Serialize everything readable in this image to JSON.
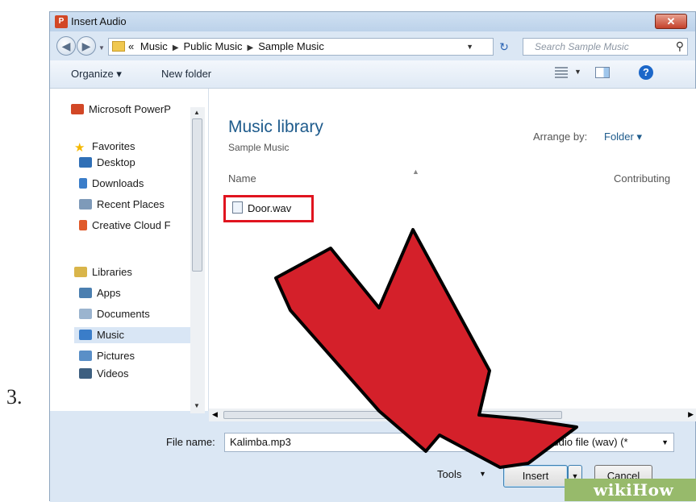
{
  "step": {
    "number": "3."
  },
  "window": {
    "title": "Insert Audio",
    "app_icon": "P"
  },
  "address": {
    "prefix": "«",
    "crumbs": [
      "Music",
      "Public Music",
      "Sample Music"
    ],
    "search_placeholder": "Search Sample Music"
  },
  "toolbar": {
    "organize_label": "Organize ▾",
    "new_folder_label": "New folder"
  },
  "sidebar": {
    "items": [
      {
        "label": "Microsoft PowerP",
        "icon": "powerpoint-icon",
        "color": "#d24726"
      },
      {
        "label": "Favorites",
        "icon": "star-icon",
        "color": "#f5b800"
      },
      {
        "label": "Desktop",
        "icon": "desktop-icon",
        "color": "#2f6fb6"
      },
      {
        "label": "Downloads",
        "icon": "downloads-icon",
        "color": "#3a7dc9"
      },
      {
        "label": "Recent Places",
        "icon": "recent-places-icon",
        "color": "#7e9ab9"
      },
      {
        "label": "Creative Cloud F",
        "icon": "creative-cloud-icon",
        "color": "#e05a2a"
      },
      {
        "label": "Libraries",
        "icon": "libraries-icon",
        "color": "#d9b54a"
      },
      {
        "label": "Apps",
        "icon": "apps-icon",
        "color": "#4b7fb0"
      },
      {
        "label": "Documents",
        "icon": "documents-icon",
        "color": "#9bb4cf"
      },
      {
        "label": "Music",
        "icon": "music-icon",
        "color": "#3a7dc9"
      },
      {
        "label": "Pictures",
        "icon": "pictures-icon",
        "color": "#5a8fc7"
      },
      {
        "label": "Videos",
        "icon": "videos-icon",
        "color": "#3d5f80"
      }
    ]
  },
  "content": {
    "library_title": "Music library",
    "library_subtitle": "Sample Music",
    "arrange_label": "Arrange by:",
    "arrange_value": "Folder ▾",
    "col_name": "Name",
    "col_contributing": "Contributing",
    "files": [
      {
        "name": "Door.wav"
      }
    ]
  },
  "footer": {
    "file_name_label": "File name:",
    "file_name_value": "Kalimba.mp3",
    "file_type_value": "ndows audio file (wav) (*",
    "tools_label": "Tools",
    "insert_label": "Insert",
    "cancel_label": "Cancel"
  },
  "watermark": {
    "text": "wikiHow"
  },
  "colors": {
    "highlight": "#e0141f",
    "arrow": "#d4202a"
  }
}
